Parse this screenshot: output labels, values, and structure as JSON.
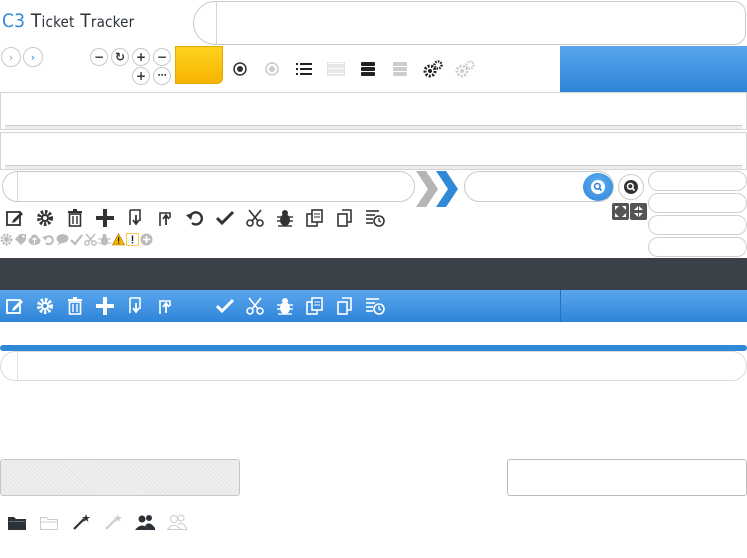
{
  "app": {
    "logo_prefix": "C3",
    "logo_word1_initial": "T",
    "logo_word1_rest": "icket",
    "logo_word2_initial": "T",
    "logo_word2_rest": "racker"
  },
  "title_field": {
    "value": "",
    "placeholder": ""
  },
  "nav": {
    "back_icon": "chevron-right-icon",
    "forward_icon": "chevron-right-blue-icon"
  },
  "mini_controls": [
    "minus",
    "refresh",
    "plus",
    "minus",
    "plus",
    "more"
  ],
  "view_icons": [
    "radio-selected-icon",
    "radio-unselected-icon",
    "list-icon",
    "list-disabled-icon",
    "stack-icon",
    "stack-disabled-icon",
    "gears-icon",
    "gears-disabled-icon"
  ],
  "search": {
    "main_value": "",
    "quick_value": ""
  },
  "toolbar_icons": [
    "edit-icon",
    "gear-icon",
    "trash-icon",
    "add-icon",
    "import-icon",
    "export-icon",
    "undo-icon",
    "check-icon",
    "scissors-icon",
    "bug-icon",
    "copy-icon",
    "duplicate-icon",
    "history-icon"
  ],
  "blue_toolbar_icons": [
    "edit-icon",
    "gear-icon",
    "trash-icon",
    "add-icon",
    "import-icon",
    "export-icon",
    "check-icon",
    "scissors-icon",
    "bug-icon",
    "copy-icon",
    "duplicate-icon",
    "history-icon"
  ],
  "tiny_icons": [
    "gear",
    "tag",
    "cloud-upload",
    "refresh",
    "chat",
    "check",
    "scissors",
    "bug",
    "warning",
    "alert-box",
    "add-circle"
  ],
  "colors": {
    "accent": "#2f89d6",
    "dark_bar": "#3a4148",
    "yellow": "#ffcc1a",
    "warning": "#f4b400"
  },
  "bottom_icons": [
    "folder-icon",
    "folder-disabled-icon",
    "magic-wand-icon",
    "magic-wand-disabled-icon",
    "users-icon",
    "users-disabled-icon"
  ]
}
